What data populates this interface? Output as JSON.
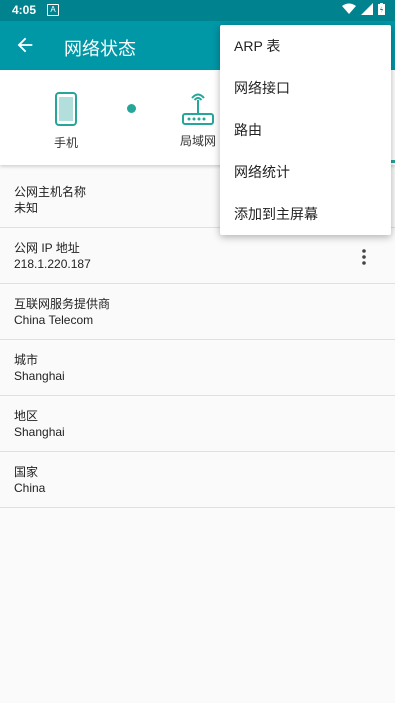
{
  "status_bar": {
    "time": "4:05",
    "notification_letter": "A"
  },
  "app_bar": {
    "title": "网络状态"
  },
  "diagram": {
    "nodes": [
      {
        "label": "手机",
        "icon": "phone-icon"
      },
      {
        "label": "局域网",
        "icon": "router-icon"
      }
    ]
  },
  "info_list": [
    {
      "label": "公网主机名称",
      "value": "未知"
    },
    {
      "label": "公网 IP 地址",
      "value": "218.1.220.187"
    },
    {
      "label": "互联网服务提供商",
      "value": "China Telecom"
    },
    {
      "label": "城市",
      "value": "Shanghai"
    },
    {
      "label": "地区",
      "value": "Shanghai"
    },
    {
      "label": "国家",
      "value": "China"
    }
  ],
  "overflow_menu": {
    "items": [
      "ARP 表",
      "网络接口",
      "路由",
      "网络统计",
      "添加到主屏幕"
    ]
  },
  "colors": {
    "primary": "#0097a7",
    "primary_dark": "#00838f",
    "accent": "#26a69a"
  }
}
